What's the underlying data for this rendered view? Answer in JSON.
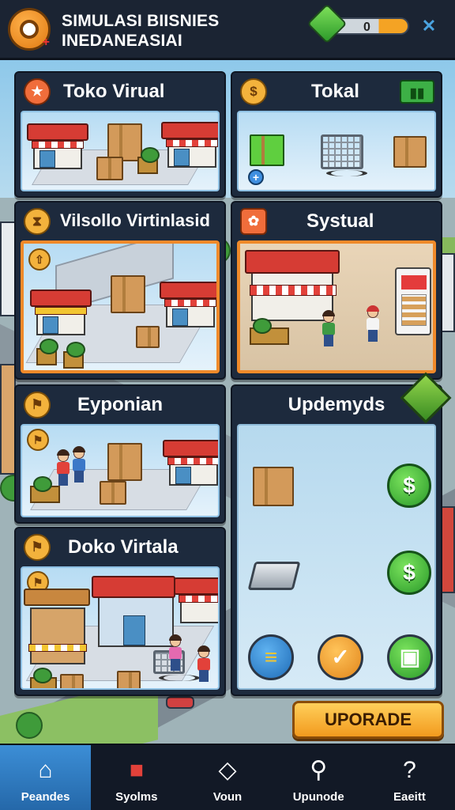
{
  "header": {
    "title_line1": "SIMULASI BIISNIES",
    "title_line2": "INEDANEASIAI",
    "currency_value": "0",
    "currency_icon": "green-gem-icon",
    "close_icon": "x-icon"
  },
  "cards": {
    "toko_virual": {
      "label": "Toko Virual",
      "badge_icon": "star-icon"
    },
    "tokal": {
      "label": "Tokal",
      "badge_icon": "dollar-coin-icon",
      "corner_icon": "green-panel-icon"
    },
    "vilsollo": {
      "label": "Vilsollo Virtinlasid",
      "badge_icon": "hourglass-icon"
    },
    "systual": {
      "label": "Systual",
      "badge_icon": "fruit-icon"
    },
    "eyponian": {
      "label": "Eyponian",
      "badge_icon": "shirt-icon"
    },
    "doko_virtala": {
      "label": "Doko Virtala",
      "badge_icon": "shirt-icon"
    }
  },
  "upgrades": {
    "title": "Updemyds",
    "row_icons": [
      "box-icon",
      "ingot-icon"
    ],
    "buy_icon": "$",
    "bottom_buttons": [
      "stack-icon",
      "checkmark-icon",
      "chip-icon"
    ]
  },
  "upgrade_button": {
    "label": "UPORADE"
  },
  "bottom_nav": [
    {
      "label": "Peandes",
      "icon": "house-icon",
      "active": true
    },
    {
      "label": "Syolms",
      "icon": "shop-icon",
      "active": false
    },
    {
      "label": "Voun",
      "icon": "diamond-icon",
      "active": false
    },
    {
      "label": "Upunode",
      "icon": "magnifier-icon",
      "active": false
    },
    {
      "label": "Eaeitt",
      "icon": "question-icon",
      "active": false
    }
  ],
  "colors": {
    "header_bg": "#1b2433",
    "card_bg": "#1d2a3d",
    "accent_orange": "#f29a1e",
    "money_green": "#2a9a2a",
    "nav_active": "#2467a8"
  }
}
